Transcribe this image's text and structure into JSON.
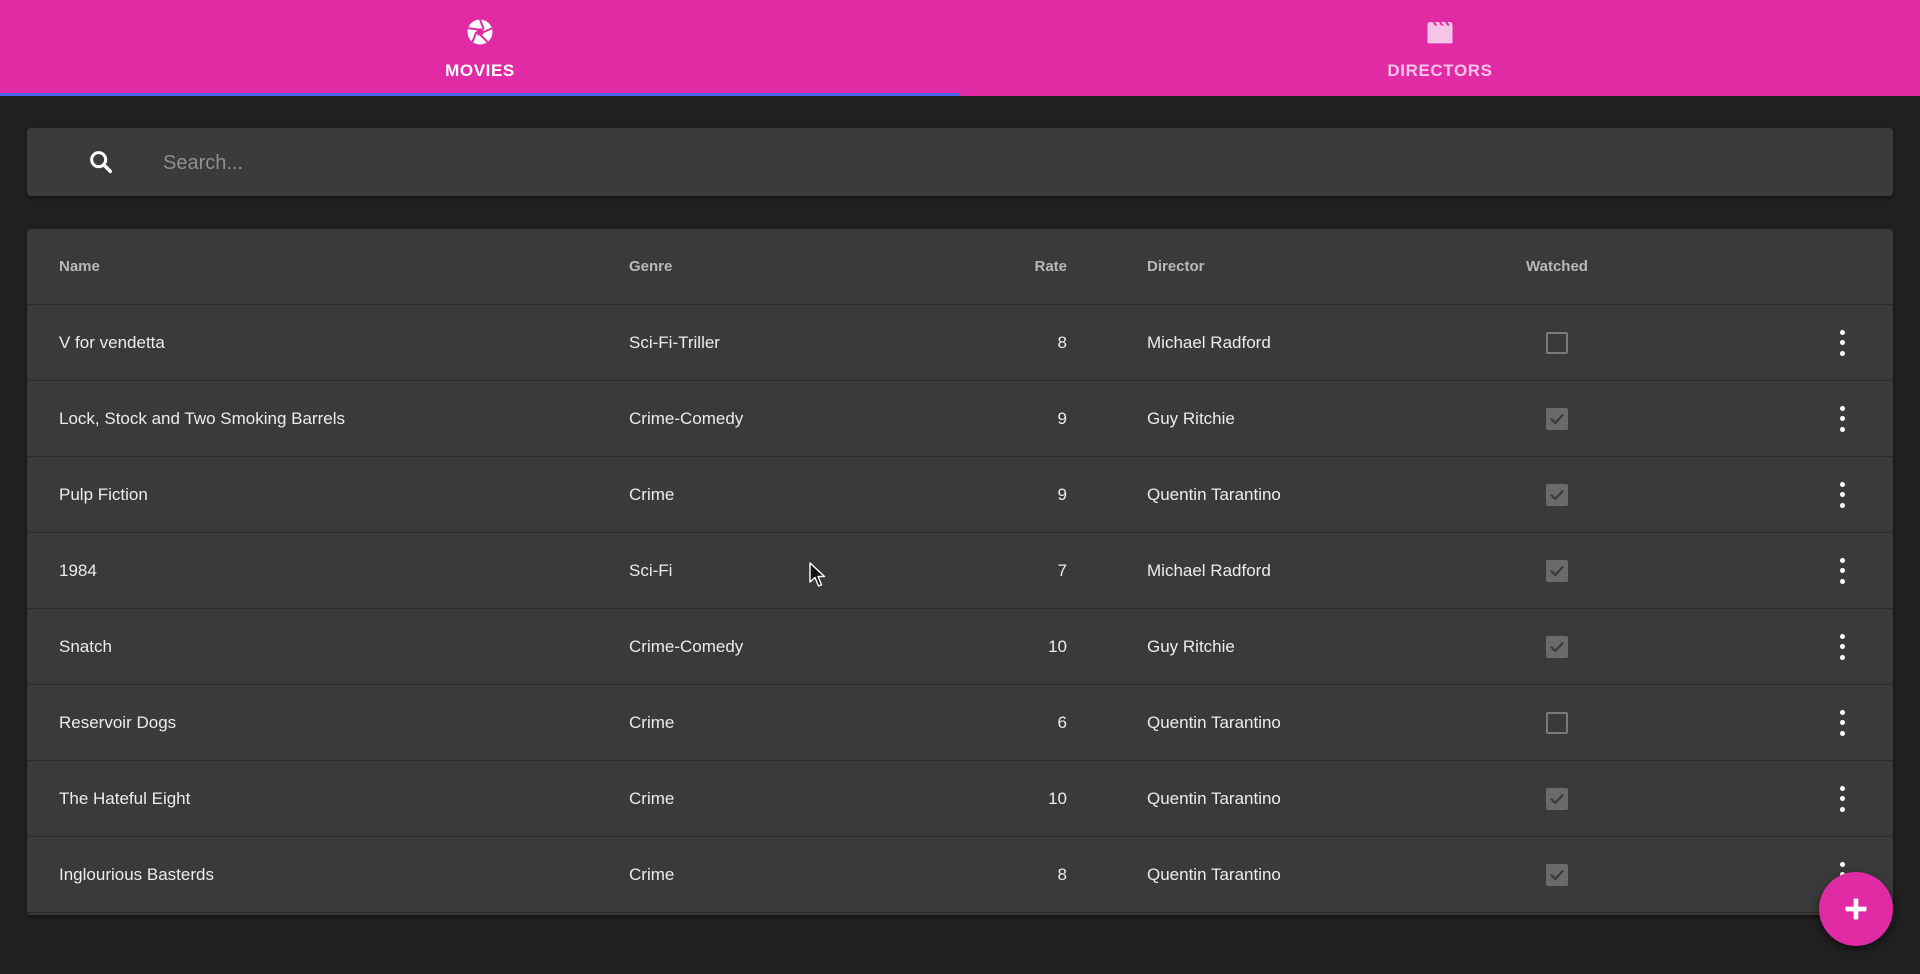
{
  "theme": {
    "accent": "#e02ba5",
    "tab_indicator": "#4a64f0",
    "background": "#202020",
    "surface": "#3a3a3a"
  },
  "tabs": [
    {
      "label": "MOVIES",
      "icon": "camera-aperture-icon",
      "active": true
    },
    {
      "label": "DIRECTORS",
      "icon": "clapperboard-icon",
      "active": false
    }
  ],
  "search": {
    "placeholder": "Search...",
    "value": "",
    "icon": "search-icon"
  },
  "table": {
    "columns": [
      "Name",
      "Genre",
      "Rate",
      "Director",
      "Watched"
    ],
    "rows": [
      {
        "name": "V for vendetta",
        "genre": "Sci-Fi-Triller",
        "rate": "8",
        "director": "Michael Radford",
        "watched": false
      },
      {
        "name": "Lock, Stock and Two Smoking Barrels",
        "genre": "Crime-Comedy",
        "rate": "9",
        "director": "Guy Ritchie",
        "watched": true
      },
      {
        "name": "Pulp Fiction",
        "genre": "Crime",
        "rate": "9",
        "director": "Quentin Tarantino",
        "watched": true
      },
      {
        "name": "1984",
        "genre": "Sci-Fi",
        "rate": "7",
        "director": "Michael Radford",
        "watched": true
      },
      {
        "name": "Snatch",
        "genre": "Crime-Comedy",
        "rate": "10",
        "director": "Guy Ritchie",
        "watched": true
      },
      {
        "name": "Reservoir Dogs",
        "genre": "Crime",
        "rate": "6",
        "director": "Quentin Tarantino",
        "watched": false
      },
      {
        "name": "The Hateful Eight",
        "genre": "Crime",
        "rate": "10",
        "director": "Quentin Tarantino",
        "watched": true
      },
      {
        "name": "Inglourious Basterds",
        "genre": "Crime",
        "rate": "8",
        "director": "Quentin Tarantino",
        "watched": true
      }
    ],
    "row_action_icon": "more-vertical-icon"
  },
  "fab": {
    "icon": "plus-icon"
  }
}
